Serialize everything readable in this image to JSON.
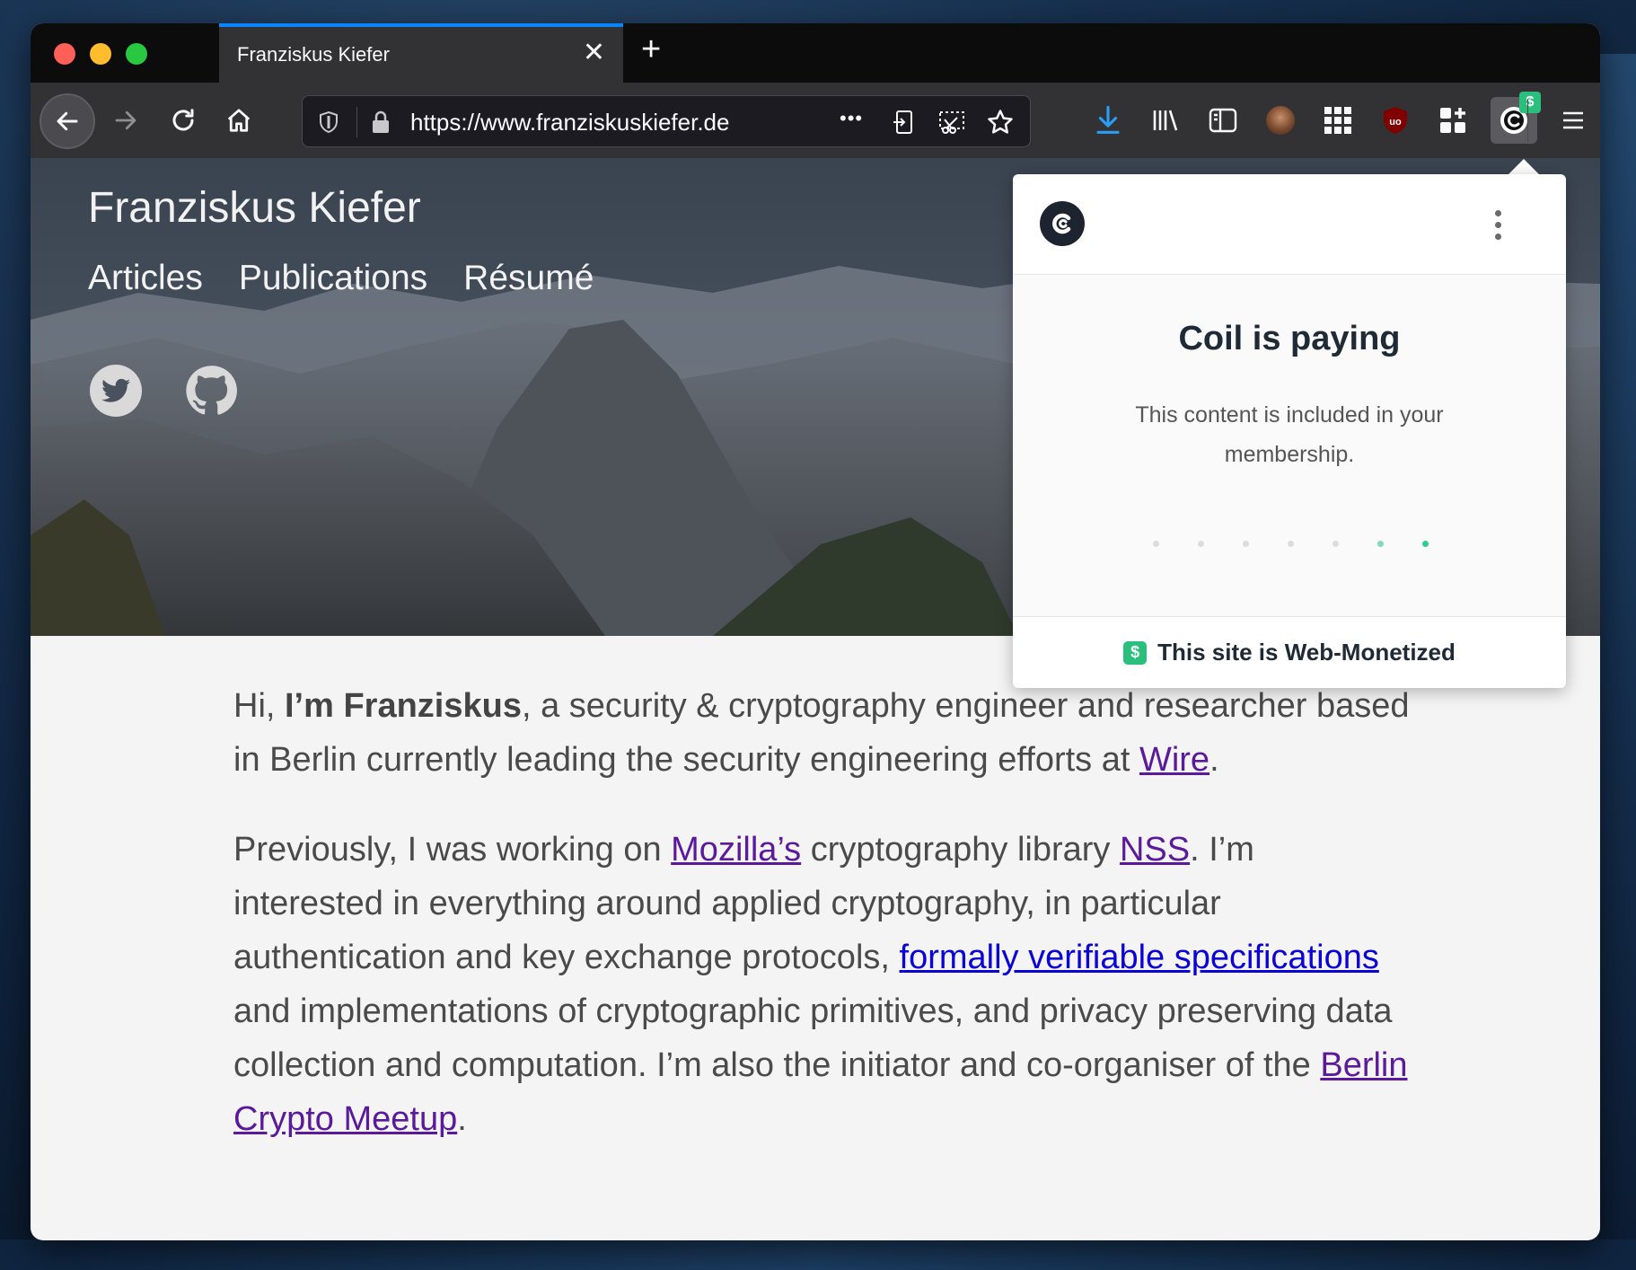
{
  "browser": {
    "tab_title": "Franziskus Kiefer",
    "tab_close": "✕",
    "new_tab": "+",
    "url": "https://www.franziskuskiefer.de",
    "url_more": "•••",
    "accent_color": "#0a84ff"
  },
  "site": {
    "title": "Franziskus Kiefer",
    "nav": [
      "Articles",
      "Publications",
      "Résumé"
    ]
  },
  "content": {
    "p1": {
      "t1": "Hi, ",
      "b1": "I’m Franziskus",
      "t2": ", a security & cryptography engineer and researcher based in Berlin currently leading the security engineering efforts at ",
      "l1": "Wire",
      "t3": "."
    },
    "p2": {
      "t1": "Previously, I was working on ",
      "l1": "Mozilla’s",
      "t2": " cryptography library ",
      "l2": "NSS",
      "t3": ". I’m interested in everything around applied cryptography, in particular authentication and key exchange protocols, ",
      "l3": "formally verifiable specifications",
      "t4": " and implementations of cryptographic primitives, and privacy preserving data collection and computation. I’m also the initiator and co-organiser of the ",
      "l4": "Berlin Crypto Meetup",
      "t5": "."
    }
  },
  "popup": {
    "title": "Coil is paying",
    "description": "This content is included in your membership.",
    "footer": "This site is Web-Monetized",
    "badge": "$",
    "progress_dots": [
      "inactive",
      "inactive",
      "inactive",
      "inactive",
      "inactive",
      "active-light",
      "active"
    ],
    "colors": {
      "inactive": "#dcdcdc",
      "active-light": "#7fdcb8",
      "active": "#2bcf8f"
    }
  }
}
